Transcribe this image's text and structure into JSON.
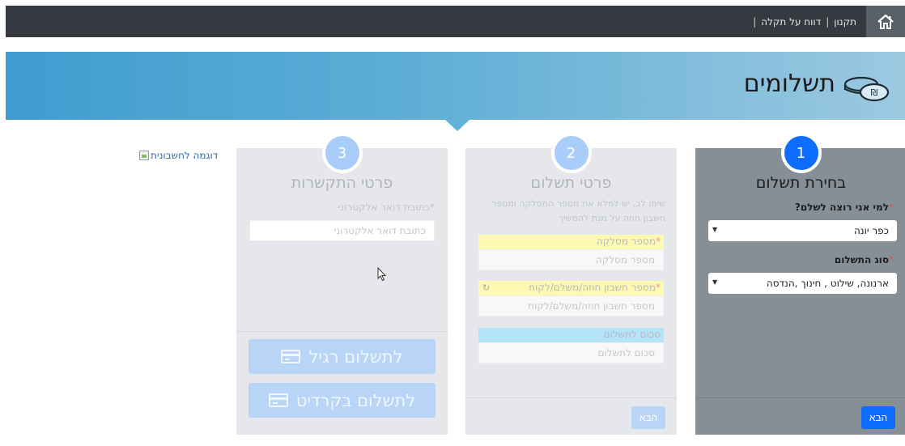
{
  "topbar": {
    "links": [
      "תקנון",
      "דווח על תקלה"
    ],
    "separator": "|"
  },
  "banner": {
    "title": "תשלומים",
    "icon": "coins-icon"
  },
  "step1": {
    "number": "1",
    "title": "בחירת תשלום",
    "payer_label": "למי אני רוצה לשלם?",
    "payer_value": "כפר יונה",
    "type_label": "סוג התשלום",
    "type_value": "ארנונה, שילוט , חינוך ,הנדסה",
    "required_mark": "*",
    "next_label": "הבא"
  },
  "step2": {
    "number": "2",
    "title": "פרטי תשלום",
    "note": "שימו לב, יש למלא את מספר המסלקה ומספר חשבון חוזה על מנת להמשיך",
    "clearing_label": "מספר מסלקה",
    "clearing_placeholder": "מספר מסלקה",
    "account_label": "מספר חשבון חוזה/משלם/לקוח",
    "account_placeholder": "מספר חשבון חוזה/משלם/לקוח",
    "amount_label": "סכום לתשלום",
    "amount_placeholder": "סכום לתשלום",
    "required_mark": "*",
    "next_label": "הבא"
  },
  "step3": {
    "number": "3",
    "title": "פרטי התקשרות",
    "email_label": "כתובת דואר אלקטרוני",
    "email_placeholder": "כתובת דואר אלקטרוני",
    "required_mark": "*",
    "regular_pay_label": "לתשלום רגיל",
    "credit_pay_label": "לתשלום בקרדיט"
  },
  "example_link": "דוגמה לחשבונית"
}
